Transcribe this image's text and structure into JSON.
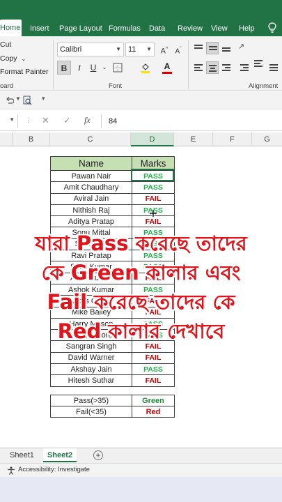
{
  "ribbon_tabs": [
    "Home",
    "Insert",
    "Page Layout",
    "Formulas",
    "Data",
    "Review",
    "View",
    "Help"
  ],
  "active_tab": "Home",
  "clipboard": {
    "cut": "Cut",
    "copy": "Copy",
    "format_painter": "Format Painter",
    "group_label": "oard"
  },
  "font": {
    "name": "Calibri",
    "size": "11",
    "group_label": "Font"
  },
  "alignment": {
    "group_label": "Alignment"
  },
  "formula_bar": {
    "value": "84",
    "fx_label": "fx"
  },
  "columns": [
    "B",
    "C",
    "D",
    "E",
    "F",
    "G"
  ],
  "selected_column": "D",
  "table": {
    "headers": [
      "Name",
      "Marks"
    ],
    "rows": [
      {
        "name": "Pawan Nair",
        "result": "PASS"
      },
      {
        "name": "Amit Chaudhary",
        "result": "PASS"
      },
      {
        "name": "Aviral Jain",
        "result": "FAIL"
      },
      {
        "name": "Nithish Raj",
        "result": "PASS"
      },
      {
        "name": "Aditya Pratap",
        "result": "FAIL"
      },
      {
        "name": "Sonu Mittal",
        "result": "PASS"
      },
      {
        "name": "Shubham",
        "result": "PASS"
      },
      {
        "name": "Ravi Pratap",
        "result": "PASS"
      },
      {
        "name": "Sunil Kumar",
        "result": "PASS"
      },
      {
        "name": "Ankit Kumar",
        "result": "FAIL"
      },
      {
        "name": "Ashok Kumar",
        "result": "PASS"
      },
      {
        "name": "Vikas Gupta",
        "result": "FAIL"
      },
      {
        "name": "Mike Bailey",
        "result": "FAIL"
      },
      {
        "name": "Harry Mason",
        "result": "PASS"
      },
      {
        "name": "Harry Moore",
        "result": "PASS"
      },
      {
        "name": "Sangran Singh",
        "result": "FAIL"
      },
      {
        "name": "David Warner",
        "result": "FAIL"
      },
      {
        "name": "Akshay Jain",
        "result": "PASS"
      },
      {
        "name": "Hitesh Suthar",
        "result": "FAIL"
      }
    ]
  },
  "legend": [
    {
      "label": "Pass(>35)",
      "color_name": "Green"
    },
    {
      "label": "Fail(<35)",
      "color_name": "Red"
    }
  ],
  "overlay_caption": [
    "যারা Pass করেছে তাদের",
    "কে Green কালার এবং",
    "Fail করেছে তাদের কে",
    "Red কালার দেখাবে"
  ],
  "sheets": [
    "Sheet1",
    "Sheet2"
  ],
  "active_sheet": "Sheet2",
  "status": {
    "accessibility": "Accessibility: Investigate"
  },
  "colors": {
    "excel_green": "#217346",
    "pass": "#22b14c",
    "fail": "#c00000",
    "header_fill": "#c6e0b4",
    "caption": "#e1141b"
  }
}
